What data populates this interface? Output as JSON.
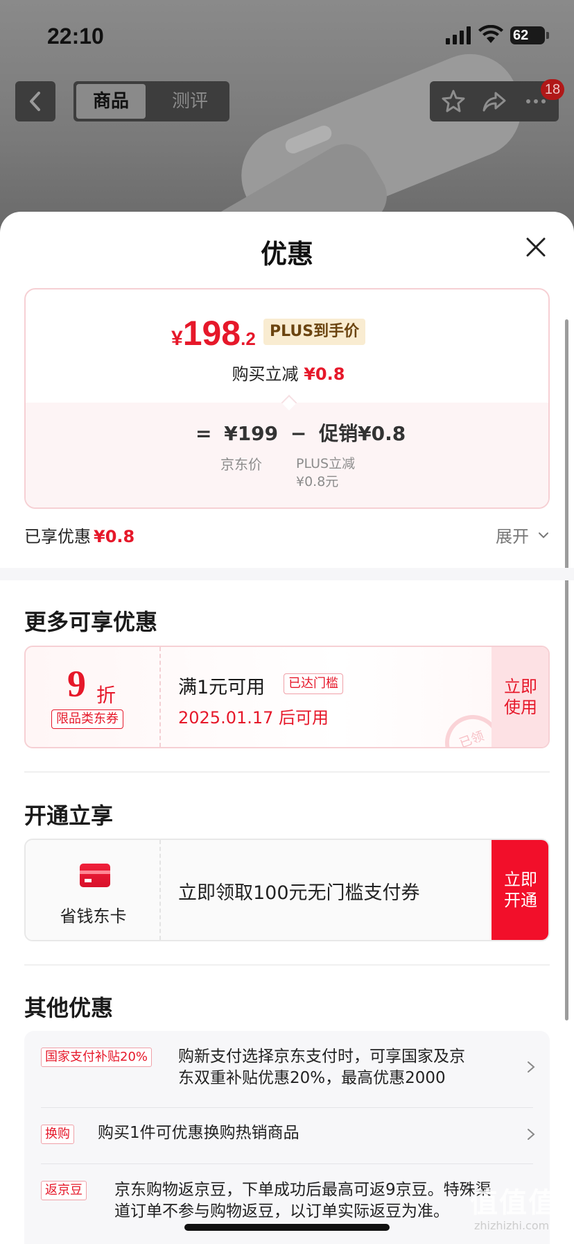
{
  "status_bar": {
    "time": "22:10",
    "battery": "62"
  },
  "nav": {
    "tabs": [
      "商品",
      "测评"
    ],
    "badge": "18"
  },
  "sheet": {
    "title": "优惠"
  },
  "price_card": {
    "currency": "¥",
    "price_int": "198",
    "price_dec": ".2",
    "plus_tag": "PLUS到手价",
    "instant_label": "购买立减",
    "instant_value": "¥0.8",
    "eq": "=",
    "jd_price": "¥199",
    "minus": "−",
    "promo": "促销¥0.8",
    "jd_price_label": "京东价",
    "promo_label_1": "PLUS立减",
    "promo_label_2": "¥0.8元"
  },
  "enjoyed": {
    "label": "已享优惠",
    "value": "¥0.8",
    "expand": "展开"
  },
  "more_section": {
    "title": "更多可享优惠"
  },
  "coupon": {
    "num": "9",
    "unit": "折",
    "tag": "限品类东券",
    "condition": "满1元可用",
    "reached": "已达门槛",
    "date": "2025.01.17 后可用",
    "button": "立即\n使用",
    "stamp": "已领"
  },
  "open_section": {
    "title": "开通立享"
  },
  "open_card": {
    "name": "省钱东卡",
    "text": "立即领取100元无门槛支付券",
    "button": "立即\n开通"
  },
  "other_section": {
    "title": "其他优惠"
  },
  "others": [
    {
      "tag": "国家支付补贴20%",
      "line1": "购新支付选择京东支付时，可享国家及京",
      "line2": "东双重补贴优惠20%，最高优惠2000"
    },
    {
      "tag": "换购",
      "line1": "购买1件可优惠换购热销商品",
      "line2": ""
    },
    {
      "tag": "返京豆",
      "line1": "京东购物返京豆，下单成功后最高可返9京豆。特殊渠",
      "line2": "道订单不参与购物返豆，以订单实际返豆为准。"
    }
  ],
  "watermark": {
    "main": "值值值",
    "sub": "zhizhizhi.com"
  }
}
